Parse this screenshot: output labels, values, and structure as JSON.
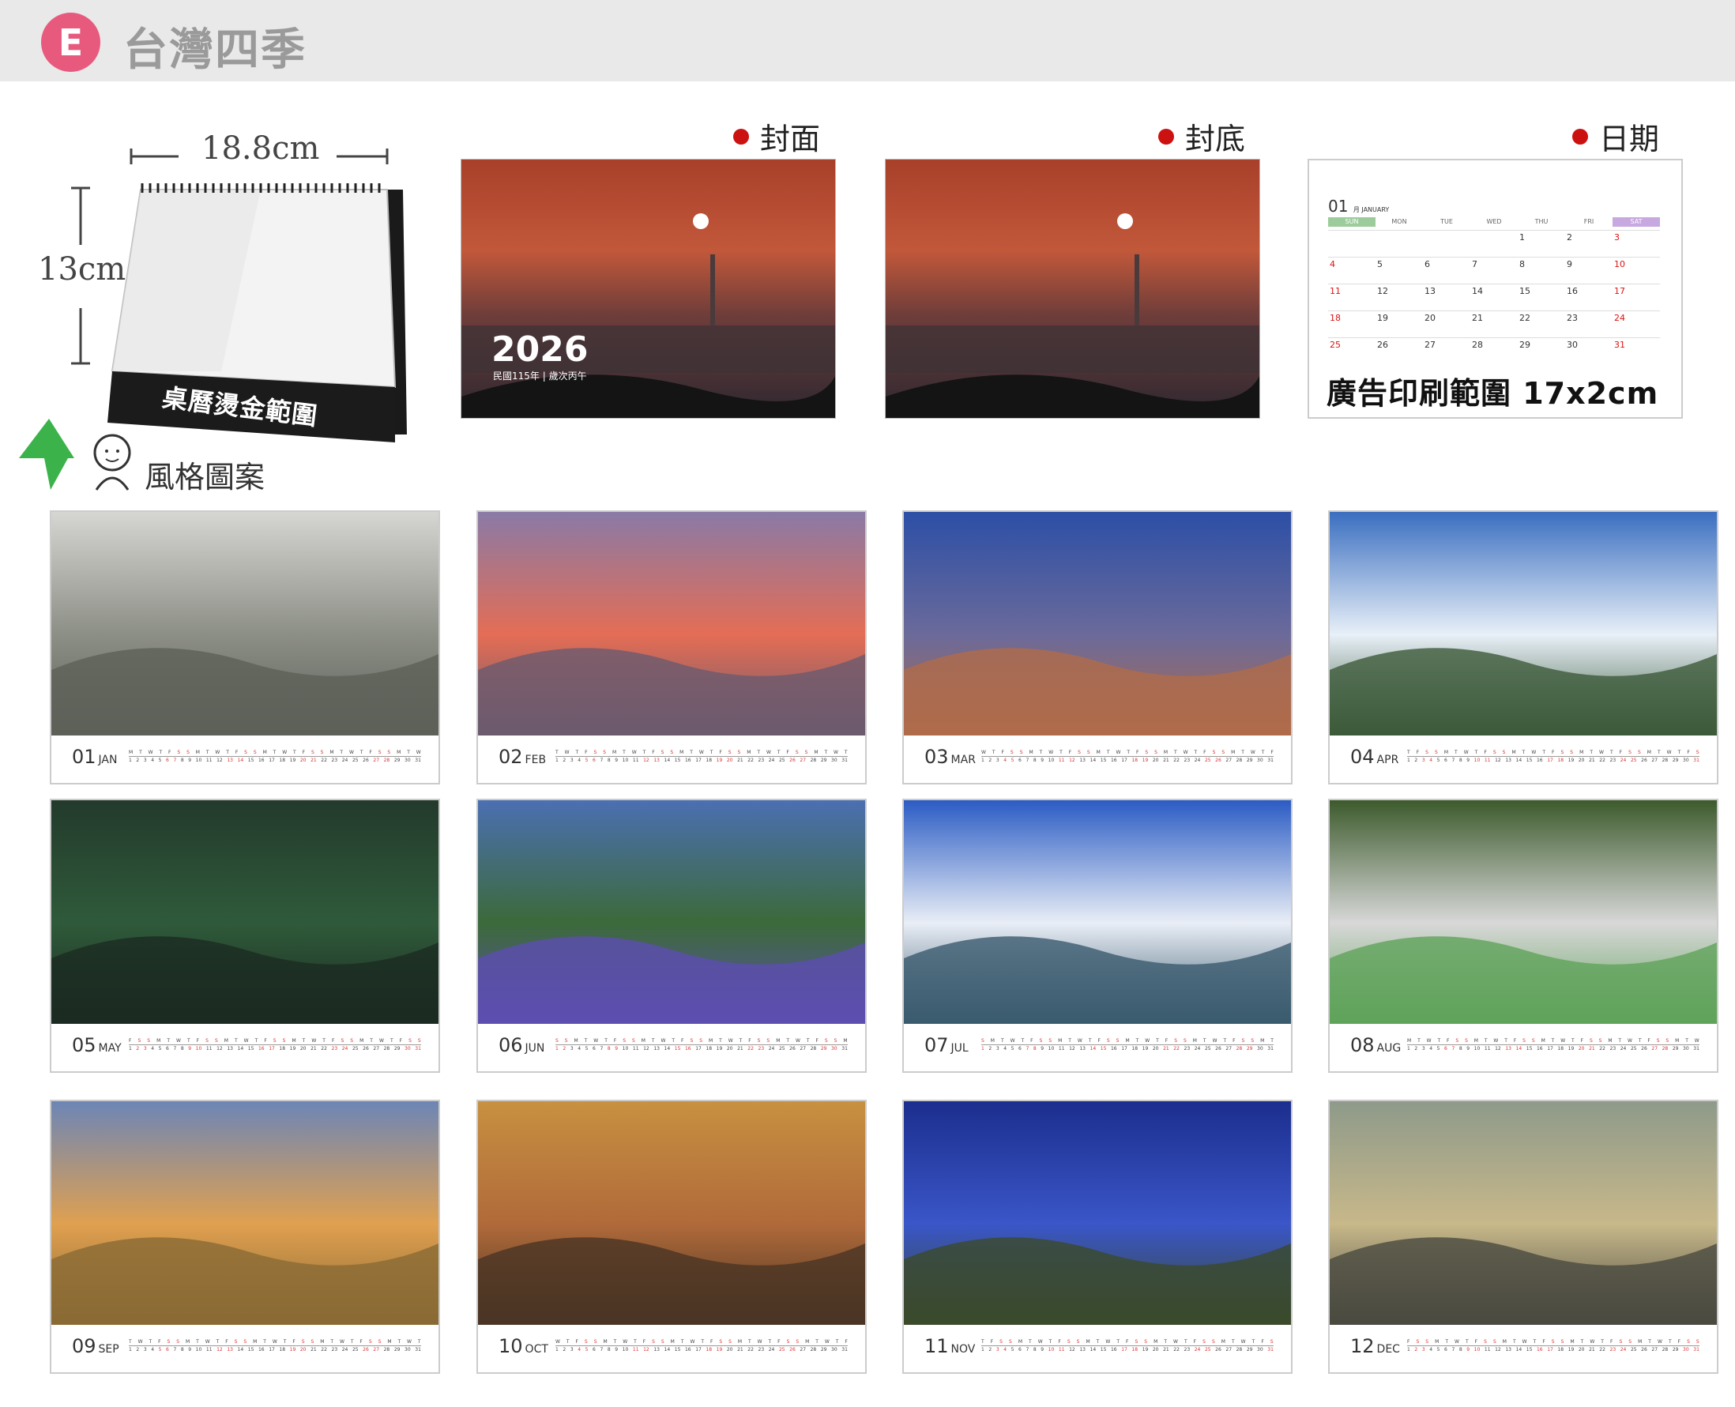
{
  "header": {
    "badge": "E",
    "title": "台灣四季"
  },
  "desk": {
    "width_label": "18.8cm",
    "height_label": "13cm",
    "gold_label": "桌曆燙金範圍",
    "style_label": "風格圖案"
  },
  "previews": {
    "front_label": "封面",
    "back_label": "封底",
    "date_label": "日期",
    "cover_year": "2026",
    "cover_sub": "民國115年 | 歲次丙午"
  },
  "date_sample": {
    "month": "01",
    "month_en": "月 JANUARY",
    "weekdays": [
      "SUN",
      "MON",
      "TUE",
      "WED",
      "THU",
      "FRI",
      "SAT"
    ],
    "ad_text": "廣告印刷範圍 17x2cm"
  },
  "months": [
    {
      "num": "01",
      "abbr": "JAN"
    },
    {
      "num": "02",
      "abbr": "FEB"
    },
    {
      "num": "03",
      "abbr": "MAR"
    },
    {
      "num": "04",
      "abbr": "APR"
    },
    {
      "num": "05",
      "abbr": "MAY"
    },
    {
      "num": "06",
      "abbr": "JUN"
    },
    {
      "num": "07",
      "abbr": "JUL"
    },
    {
      "num": "08",
      "abbr": "AUG"
    },
    {
      "num": "09",
      "abbr": "SEP"
    },
    {
      "num": "10",
      "abbr": "OCT"
    },
    {
      "num": "11",
      "abbr": "NOV"
    },
    {
      "num": "12",
      "abbr": "DEC"
    }
  ],
  "colors": {
    "badge": "#e85a7d",
    "title": "#9a9a9a",
    "dot": "#cc1111",
    "weekend": "#d33333"
  }
}
